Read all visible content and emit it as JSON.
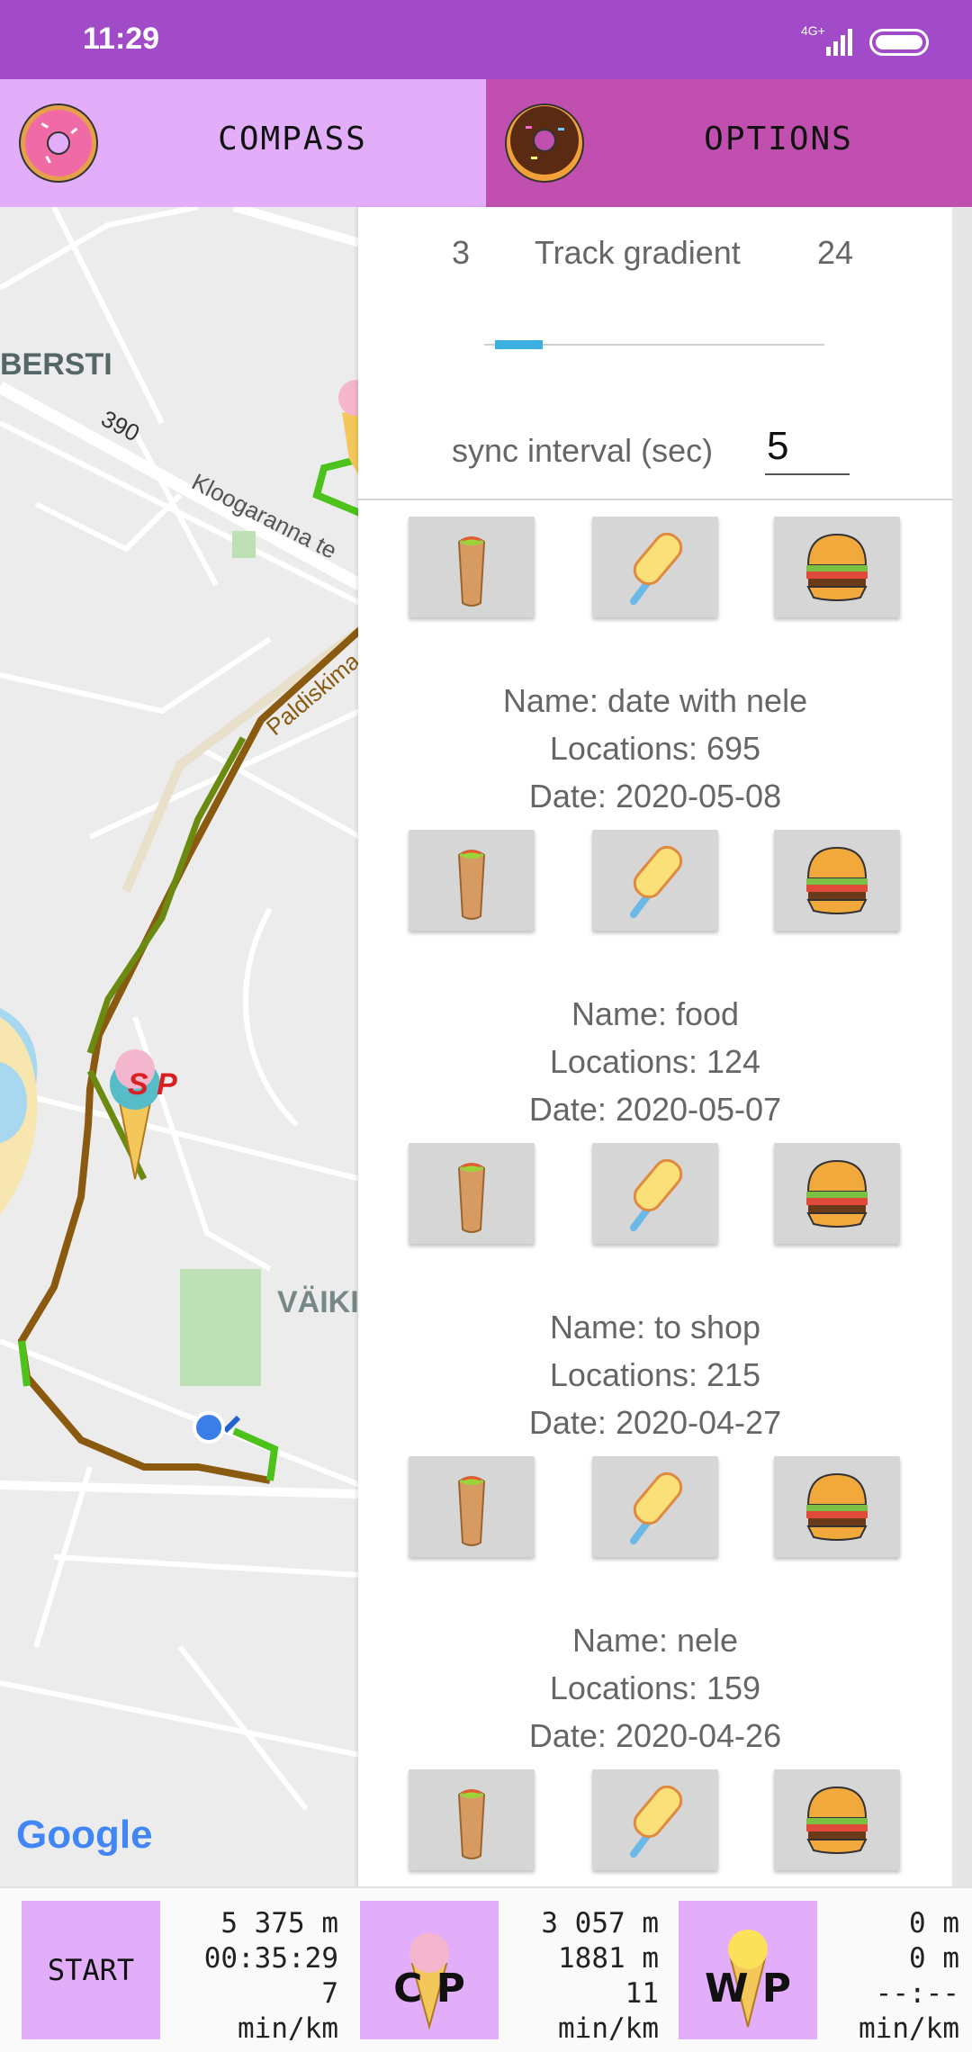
{
  "status_bar": {
    "time": "11:29",
    "network": "4G+"
  },
  "tabs": [
    {
      "label": "COMPASS",
      "icon": "pink-donut-icon"
    },
    {
      "label": "OPTIONS",
      "icon": "chocolate-donut-icon"
    }
  ],
  "map": {
    "labels": {
      "district_top": "BERSTI",
      "road_number": "390",
      "street_1": "Kloogaranna te",
      "street_2": "Paldiskima",
      "district_bottom": "VÄIKI"
    },
    "marker_text": "S P",
    "attribution": "Google"
  },
  "options": {
    "gradient": {
      "min": "3",
      "title": "Track gradient",
      "max": "24",
      "level": 0.14
    },
    "sync": {
      "label": "sync interval (sec)",
      "value": "5"
    },
    "tracks": [
      {
        "name": "Name: date with nele",
        "locations": "Locations: 695",
        "date": "Date: 2020-05-08"
      },
      {
        "name": "Name: food",
        "locations": "Locations: 124",
        "date": "Date: 2020-05-07"
      },
      {
        "name": "Name: to shop",
        "locations": "Locations: 215",
        "date": "Date: 2020-04-27"
      },
      {
        "name": "Name: nele",
        "locations": "Locations: 159",
        "date": "Date: 2020-04-26"
      }
    ],
    "track_button_icons": [
      "burrito-icon",
      "popsicle-icon",
      "burger-icon"
    ]
  },
  "bottom": {
    "start_label": "START",
    "stats_total": [
      "5 375 m",
      "00:35:29",
      "7",
      "min/km"
    ],
    "checkpoint_label": "C P",
    "stats_checkpoint": [
      "3 057 m",
      "1881 m",
      "11",
      "min/km"
    ],
    "waypoint_label": "W P",
    "stats_waypoint": [
      "0 m",
      "0 m",
      "--:--",
      "min/km"
    ]
  },
  "colors": {
    "status_bar": "#a24bc8",
    "tab_compass": "#e3aef9",
    "tab_options": "#c14fb0",
    "slider": "#3bb0e0",
    "track_green": "#4cc21a",
    "track_brown": "#8a5a10"
  }
}
